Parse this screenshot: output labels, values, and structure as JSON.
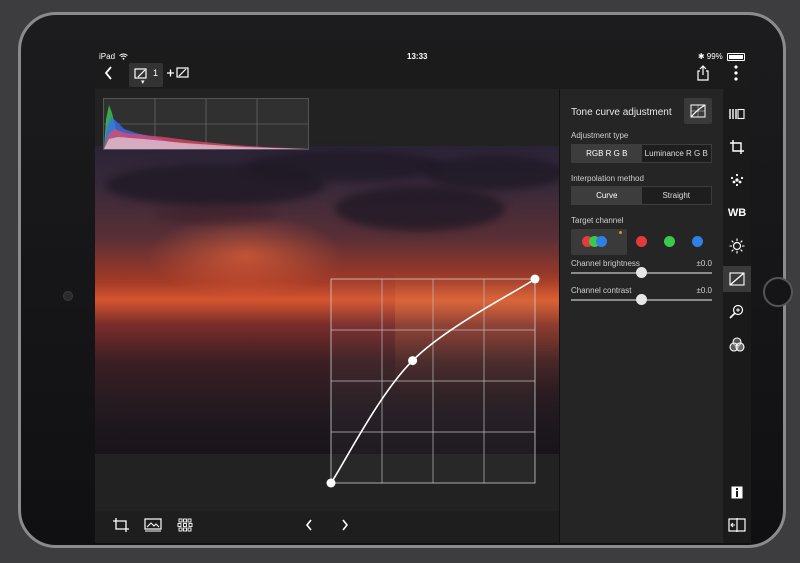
{
  "status": {
    "device": "iPad",
    "time": "13:33",
    "battery": "99%",
    "bluetooth": "bluetooth-icon",
    "wifi": "wifi-icon"
  },
  "toolbar": {
    "back_icon": "chevron-left-icon",
    "version_count": "1",
    "add_version_icon": "plus-icon",
    "share_icon": "share-icon",
    "more_icon": "more-vertical-icon"
  },
  "panel": {
    "title": "Tone curve adjustment",
    "adjustment_type_label": "Adjustment type",
    "adjustment_type_options": [
      "RGB R G B",
      "Luminance R G B"
    ],
    "adjustment_type_selected": "RGB R G B",
    "interpolation_label": "Interpolation method",
    "interpolation_options": [
      "Curve",
      "Straight"
    ],
    "interpolation_selected": "Curve",
    "target_channel_label": "Target channel",
    "channels": [
      "RGB",
      "Red",
      "Green",
      "Blue"
    ],
    "channel_selected": "RGB",
    "brightness_label": "Channel brightness",
    "brightness_value": "±0.0",
    "contrast_label": "Channel contrast",
    "contrast_value": "±0.0"
  },
  "curve": {
    "points": [
      [
        0,
        0
      ],
      [
        0.4,
        0.6
      ],
      [
        1,
        1
      ]
    ]
  },
  "colors": {
    "red": "#e23b3b",
    "green": "#3bc94a",
    "blue": "#2f7fe8"
  },
  "right_rail": [
    "film-strip-icon",
    "crop-icon",
    "sharpness-icon",
    "white-balance-icon",
    "brightness-icon",
    "tone-curve-icon",
    "lens-correction-icon",
    "color-adjust-icon",
    "info-icon",
    "compare-icon"
  ],
  "right_rail_wb_label": "WB",
  "bottom_toolbar": [
    "trim-icon",
    "filmstrip-view-icon",
    "grid-view-icon",
    "previous-icon",
    "next-icon"
  ]
}
